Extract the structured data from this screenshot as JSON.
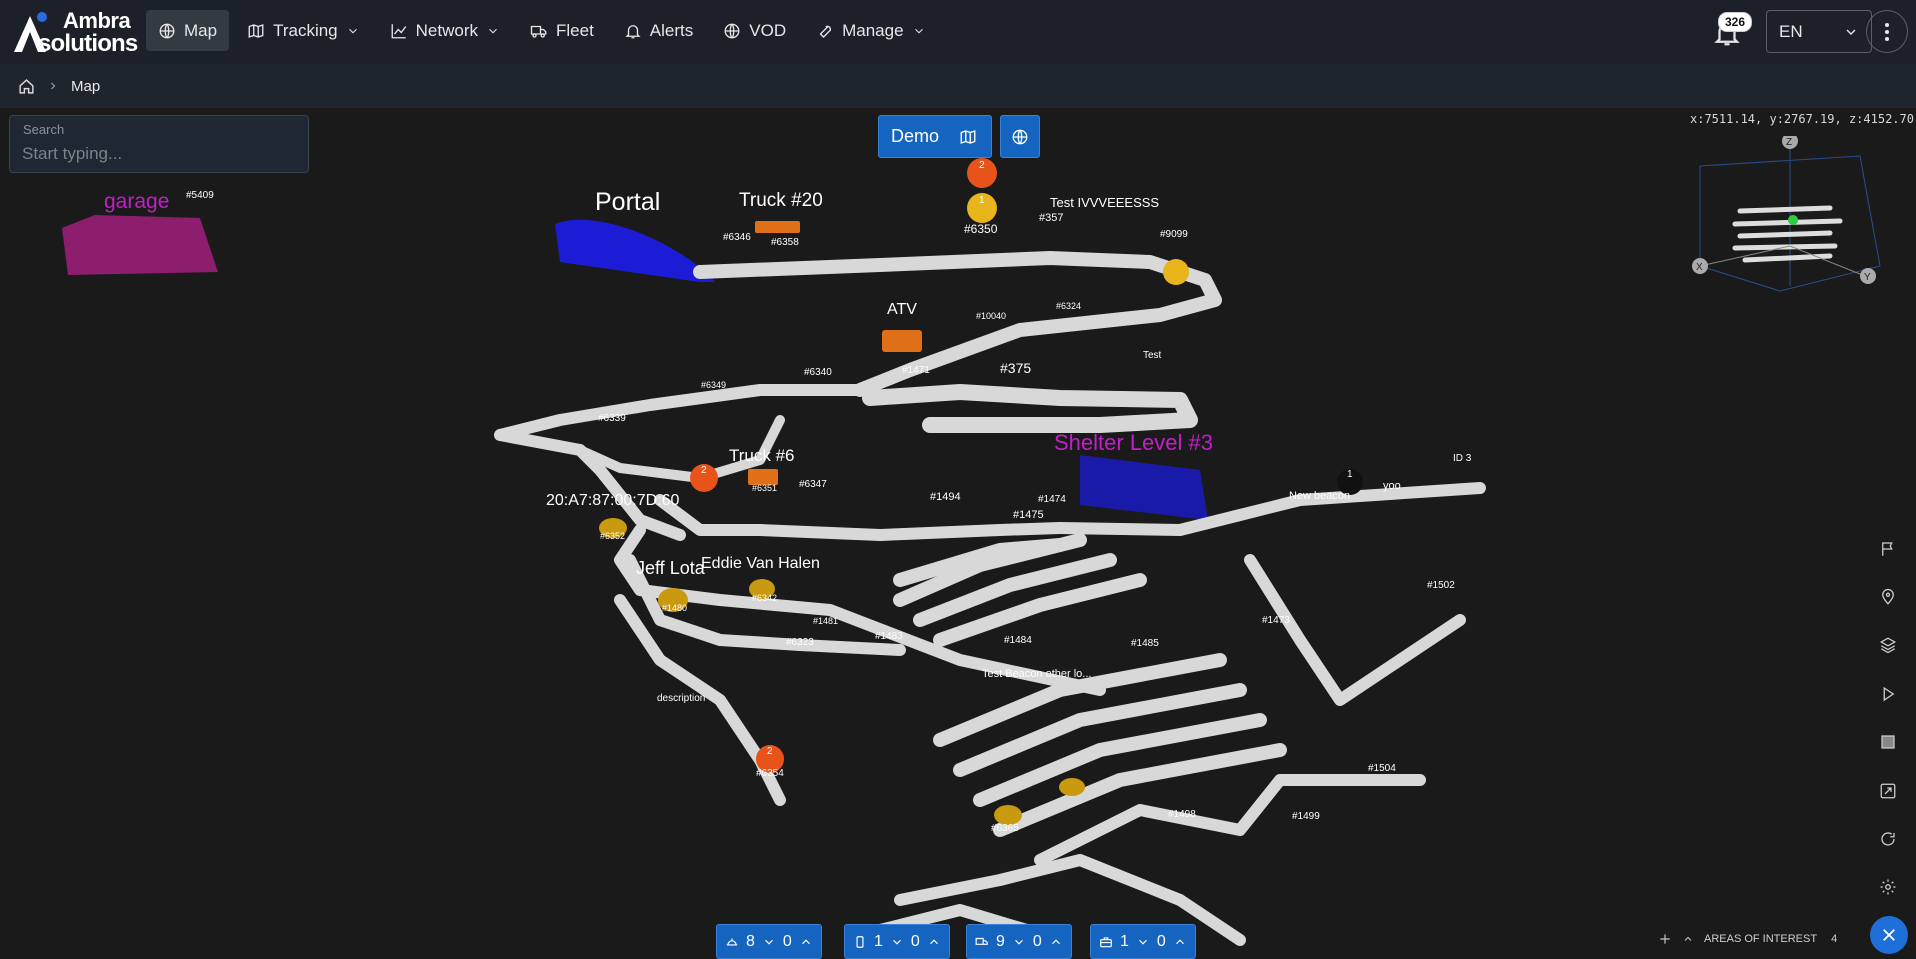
{
  "brand": {
    "name_line1": "Ambra",
    "name_line2": "solutions"
  },
  "nav": {
    "items": [
      {
        "label": "Map",
        "icon": "globe-icon",
        "active": true,
        "dropdown": false
      },
      {
        "label": "Tracking",
        "icon": "map-icon",
        "dropdown": true
      },
      {
        "label": "Network",
        "icon": "chart-line-icon",
        "dropdown": true
      },
      {
        "label": "Fleet",
        "icon": "truck-icon",
        "dropdown": false
      },
      {
        "label": "Alerts",
        "icon": "bell-icon",
        "dropdown": false
      },
      {
        "label": "VOD",
        "icon": "video-globe-icon",
        "dropdown": false
      },
      {
        "label": "Manage",
        "icon": "wrench-icon",
        "dropdown": true
      }
    ]
  },
  "notifications": {
    "count": "326"
  },
  "language": {
    "selected": "EN"
  },
  "breadcrumb": {
    "current": "Map"
  },
  "search": {
    "label": "Search",
    "placeholder": "Start typing..."
  },
  "map_controls": {
    "dataset": "Demo"
  },
  "coords": {
    "text": "x:7511.14, y:2767.19, z:4152.70"
  },
  "axis_gizmo": {
    "x": "X",
    "y": "Y",
    "z": "Z"
  },
  "areas": [
    {
      "name": "garage",
      "color": "#c21fc7"
    },
    {
      "name": "Portal",
      "color": "#1c1cd6"
    },
    {
      "name": "Shelter Level #3",
      "color": "#c21fc7"
    }
  ],
  "labels": {
    "assets_large": [
      "Truck #20",
      "ATV",
      "Truck #6",
      "20:A7:87:00:7D:60",
      "Jeff Lota",
      "Eddie Van Halen",
      "Test IVVVEEESSS",
      "New beacon",
      "yoo",
      "Test",
      "ID 3",
      "description",
      "Test Beacon other lo..."
    ],
    "beacons": [
      "#5409",
      "#6346",
      "#6358",
      "#6350",
      "#357",
      "#9099",
      "#10040",
      "#6324",
      "#6340",
      "#1471",
      "#375",
      "#6349",
      "#6339",
      "#6347",
      "#1494",
      "#1474",
      "#1475",
      "#1502",
      "#1481",
      "#6323",
      "#1483",
      "#1484",
      "#1485",
      "#1473",
      "#6354",
      "#1504",
      "#1498",
      "#1499",
      "#6365",
      "#6352",
      "#6351",
      "#1480",
      "#6342"
    ]
  },
  "cluster_badges": [
    "2",
    "1",
    "2",
    "2",
    "1"
  ],
  "right_tools": [
    {
      "name": "flag-icon"
    },
    {
      "name": "location-pin-icon"
    },
    {
      "name": "layers-icon"
    },
    {
      "name": "play-icon"
    },
    {
      "name": "texture-icon"
    },
    {
      "name": "fit-screen-icon"
    },
    {
      "name": "refresh-icon"
    },
    {
      "name": "settings-icon"
    }
  ],
  "counters": [
    {
      "icon": "hardhat-icon",
      "total": "8",
      "alerts": "0"
    },
    {
      "icon": "phone-icon",
      "total": "1",
      "alerts": "0"
    },
    {
      "icon": "truck-icon",
      "total": "9",
      "alerts": "0"
    },
    {
      "icon": "toolbox-icon",
      "total": "1",
      "alerts": "0"
    }
  ],
  "areas_of_interest": {
    "label": "AREAS OF INTEREST",
    "count": "4"
  },
  "colors": {
    "accent": "#1565c0",
    "tunnel": "#d9d9d9",
    "orange": "#e8531c",
    "yellow": "#e8b51c"
  }
}
